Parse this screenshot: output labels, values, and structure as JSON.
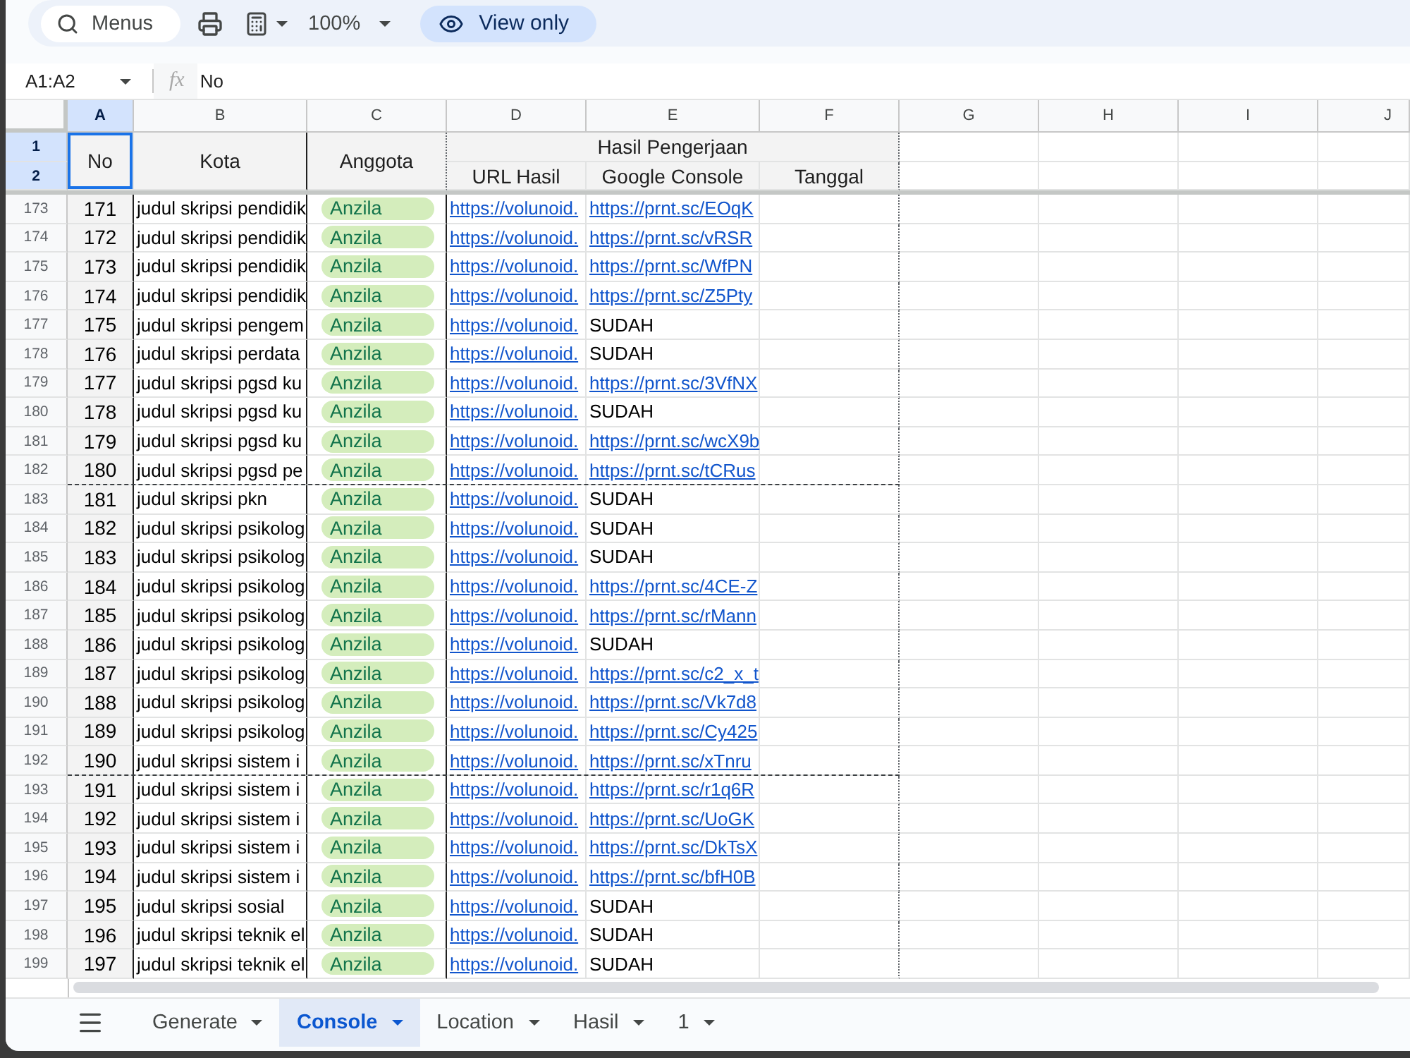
{
  "toolbar": {
    "search_menus": "Menus",
    "zoom": "100%",
    "mode": "View only"
  },
  "formula_bar": {
    "name_box": "A1:A2",
    "fx": "fx",
    "formula": "No"
  },
  "columns": [
    {
      "label": "A",
      "selected": true
    },
    {
      "label": "B",
      "selected": false
    },
    {
      "label": "C",
      "selected": false
    },
    {
      "label": "D",
      "selected": false
    },
    {
      "label": "E",
      "selected": false
    },
    {
      "label": "F",
      "selected": false
    },
    {
      "label": "G",
      "selected": false
    },
    {
      "label": "H",
      "selected": false
    },
    {
      "label": "I",
      "selected": false
    },
    {
      "label": "J",
      "selected": false
    }
  ],
  "header_rows": [
    {
      "number": "1",
      "selected": true
    },
    {
      "number": "2",
      "selected": true
    }
  ],
  "header_cells": [
    {
      "text": "No",
      "selected": true
    },
    {
      "text": "Kota",
      "selected": false
    },
    {
      "text": "Anggota",
      "selected": false
    },
    {
      "text": "Hasil Pengerjaan",
      "selected": false,
      "children": [
        {
          "text": "URL Hasil",
          "selected": false
        },
        {
          "text": "Google Console",
          "selected": false
        },
        {
          "text": "Tanggal",
          "selected": false
        }
      ]
    }
  ],
  "rows": [
    {
      "number": "173",
      "selected": false,
      "no": "171",
      "kota": "judul skripsi pendidik",
      "anggota": "Anzila",
      "url": "https://volunoid.",
      "console": {
        "kind": "link",
        "text": "https://prnt.sc/EOqK"
      },
      "page_break_after": false
    },
    {
      "number": "174",
      "selected": false,
      "no": "172",
      "kota": "judul skripsi pendidik",
      "anggota": "Anzila",
      "url": "https://volunoid.",
      "console": {
        "kind": "link",
        "text": "https://prnt.sc/vRSR"
      },
      "page_break_after": false
    },
    {
      "number": "175",
      "selected": false,
      "no": "173",
      "kota": "judul skripsi pendidik",
      "anggota": "Anzila",
      "url": "https://volunoid.",
      "console": {
        "kind": "link",
        "text": "https://prnt.sc/WfPN"
      },
      "page_break_after": false
    },
    {
      "number": "176",
      "selected": false,
      "no": "174",
      "kota": "judul skripsi pendidik",
      "anggota": "Anzila",
      "url": "https://volunoid.",
      "console": {
        "kind": "link",
        "text": "https://prnt.sc/Z5Pty"
      },
      "page_break_after": false
    },
    {
      "number": "177",
      "selected": false,
      "no": "175",
      "kota": "judul skripsi pengem",
      "anggota": "Anzila",
      "url": "https://volunoid.",
      "console": {
        "kind": "text",
        "text": "SUDAH"
      },
      "page_break_after": false
    },
    {
      "number": "178",
      "selected": false,
      "no": "176",
      "kota": "judul skripsi perdata",
      "anggota": "Anzila",
      "url": "https://volunoid.",
      "console": {
        "kind": "text",
        "text": "SUDAH"
      },
      "page_break_after": false
    },
    {
      "number": "179",
      "selected": false,
      "no": "177",
      "kota": "judul skripsi pgsd ku",
      "anggota": "Anzila",
      "url": "https://volunoid.",
      "console": {
        "kind": "link",
        "text": "https://prnt.sc/3VfNX"
      },
      "page_break_after": false
    },
    {
      "number": "180",
      "selected": false,
      "no": "178",
      "kota": "judul skripsi pgsd ku",
      "anggota": "Anzila",
      "url": "https://volunoid.",
      "console": {
        "kind": "text",
        "text": "SUDAH"
      },
      "page_break_after": false
    },
    {
      "number": "181",
      "selected": false,
      "no": "179",
      "kota": "judul skripsi pgsd ku",
      "anggota": "Anzila",
      "url": "https://volunoid.",
      "console": {
        "kind": "link",
        "text": "https://prnt.sc/wcX9b"
      },
      "page_break_after": false
    },
    {
      "number": "182",
      "selected": false,
      "no": "180",
      "kota": "judul skripsi pgsd pe",
      "anggota": "Anzila",
      "url": "https://volunoid.",
      "console": {
        "kind": "link",
        "text": "https://prnt.sc/tCRus"
      },
      "page_break_after": true
    },
    {
      "number": "183",
      "selected": false,
      "no": "181",
      "kota": "judul skripsi pkn",
      "anggota": "Anzila",
      "url": "https://volunoid.",
      "console": {
        "kind": "text",
        "text": "SUDAH"
      },
      "page_break_after": false
    },
    {
      "number": "184",
      "selected": false,
      "no": "182",
      "kota": "judul skripsi psikolog",
      "anggota": "Anzila",
      "url": "https://volunoid.",
      "console": {
        "kind": "text",
        "text": "SUDAH"
      },
      "page_break_after": false
    },
    {
      "number": "185",
      "selected": false,
      "no": "183",
      "kota": "judul skripsi psikolog",
      "anggota": "Anzila",
      "url": "https://volunoid.",
      "console": {
        "kind": "text",
        "text": "SUDAH"
      },
      "page_break_after": false
    },
    {
      "number": "186",
      "selected": false,
      "no": "184",
      "kota": "judul skripsi psikolog",
      "anggota": "Anzila",
      "url": "https://volunoid.",
      "console": {
        "kind": "link",
        "text": "https://prnt.sc/4CE-Z"
      },
      "page_break_after": false
    },
    {
      "number": "187",
      "selected": false,
      "no": "185",
      "kota": "judul skripsi psikolog",
      "anggota": "Anzila",
      "url": "https://volunoid.",
      "console": {
        "kind": "link",
        "text": "https://prnt.sc/rMann"
      },
      "page_break_after": false
    },
    {
      "number": "188",
      "selected": false,
      "no": "186",
      "kota": "judul skripsi psikolog",
      "anggota": "Anzila",
      "url": "https://volunoid.",
      "console": {
        "kind": "text",
        "text": "SUDAH"
      },
      "page_break_after": false
    },
    {
      "number": "189",
      "selected": false,
      "no": "187",
      "kota": "judul skripsi psikolog",
      "anggota": "Anzila",
      "url": "https://volunoid.",
      "console": {
        "kind": "link",
        "text": "https://prnt.sc/c2_x_t"
      },
      "page_break_after": false
    },
    {
      "number": "190",
      "selected": false,
      "no": "188",
      "kota": "judul skripsi psikolog",
      "anggota": "Anzila",
      "url": "https://volunoid.",
      "console": {
        "kind": "link",
        "text": "https://prnt.sc/Vk7d8"
      },
      "page_break_after": false
    },
    {
      "number": "191",
      "selected": false,
      "no": "189",
      "kota": "judul skripsi psikolog",
      "anggota": "Anzila",
      "url": "https://volunoid.",
      "console": {
        "kind": "link",
        "text": "https://prnt.sc/Cy425"
      },
      "page_break_after": false
    },
    {
      "number": "192",
      "selected": false,
      "no": "190",
      "kota": "judul skripsi sistem i",
      "anggota": "Anzila",
      "url": "https://volunoid.",
      "console": {
        "kind": "link",
        "text": "https://prnt.sc/xTnru"
      },
      "page_break_after": true
    },
    {
      "number": "193",
      "selected": false,
      "no": "191",
      "kota": "judul skripsi sistem i",
      "anggota": "Anzila",
      "url": "https://volunoid.",
      "console": {
        "kind": "link",
        "text": "https://prnt.sc/r1q6R"
      },
      "page_break_after": false
    },
    {
      "number": "194",
      "selected": false,
      "no": "192",
      "kota": "judul skripsi sistem i",
      "anggota": "Anzila",
      "url": "https://volunoid.",
      "console": {
        "kind": "link",
        "text": "https://prnt.sc/UoGK"
      },
      "page_break_after": false
    },
    {
      "number": "195",
      "selected": false,
      "no": "193",
      "kota": "judul skripsi sistem i",
      "anggota": "Anzila",
      "url": "https://volunoid.",
      "console": {
        "kind": "link",
        "text": "https://prnt.sc/DkTsX"
      },
      "page_break_after": false
    },
    {
      "number": "196",
      "selected": false,
      "no": "194",
      "kota": "judul skripsi sistem i",
      "anggota": "Anzila",
      "url": "https://volunoid.",
      "console": {
        "kind": "link",
        "text": "https://prnt.sc/bfH0B"
      },
      "page_break_after": false
    },
    {
      "number": "197",
      "selected": false,
      "no": "195",
      "kota": "judul skripsi sosial",
      "anggota": "Anzila",
      "url": "https://volunoid.",
      "console": {
        "kind": "text",
        "text": "SUDAH"
      },
      "page_break_after": false
    },
    {
      "number": "198",
      "selected": false,
      "no": "196",
      "kota": "judul skripsi teknik el",
      "anggota": "Anzila",
      "url": "https://volunoid.",
      "console": {
        "kind": "text",
        "text": "SUDAH"
      },
      "page_break_after": false
    },
    {
      "number": "199",
      "selected": false,
      "no": "197",
      "kota": "judul skripsi teknik el",
      "anggota": "Anzila",
      "url": "https://volunoid.",
      "console": {
        "kind": "text",
        "text": "SUDAH"
      },
      "page_break_after": false
    }
  ],
  "sheet_tabs": [
    {
      "label": "Generate",
      "selected": false
    },
    {
      "label": "Console",
      "selected": true
    },
    {
      "label": "Location",
      "selected": false
    },
    {
      "label": "Hasil",
      "selected": false
    },
    {
      "label": "1",
      "selected": false
    }
  ]
}
